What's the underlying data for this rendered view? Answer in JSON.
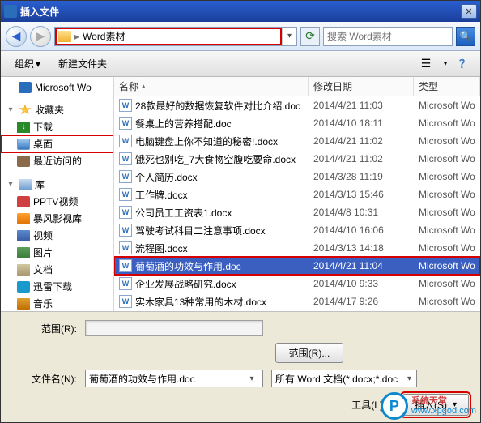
{
  "title": "插入文件",
  "titlebar": {
    "close_symbol": "✕"
  },
  "nav": {
    "back_symbol": "◀",
    "forward_symbol": "▶",
    "path_sep": "▸",
    "path_label": "Word素材",
    "dropdown_symbol": "▾",
    "refresh_symbol": "⟳",
    "search_placeholder": "搜索 Word素材",
    "search_icon": "🔍"
  },
  "toolbar": {
    "organize_label": "组织",
    "new_folder_label": "新建文件夹",
    "dropdown_symbol": "▾",
    "view_icon": "☰",
    "help_icon": "？"
  },
  "sidebar": {
    "items": [
      {
        "label": "Microsoft Wo",
        "icon": "ico-wordapp",
        "indent": 0,
        "expander": ""
      },
      {
        "label": "收藏夹",
        "icon": "ico-fav",
        "indent": 0,
        "expander": "▾"
      },
      {
        "label": "下载",
        "icon": "ico-dl",
        "indent": 1,
        "expander": ""
      },
      {
        "label": "桌面",
        "icon": "ico-desktop",
        "indent": 1,
        "expander": "",
        "highlight": true
      },
      {
        "label": "最近访问的",
        "icon": "ico-recent",
        "indent": 1,
        "expander": ""
      },
      {
        "label": "库",
        "icon": "ico-lib",
        "indent": 0,
        "expander": "▾"
      },
      {
        "label": "PPTV视频",
        "icon": "ico-pptv",
        "indent": 1,
        "expander": ""
      },
      {
        "label": "暴风影视库",
        "icon": "ico-baofeng",
        "indent": 1,
        "expander": ""
      },
      {
        "label": "视频",
        "icon": "ico-video",
        "indent": 1,
        "expander": ""
      },
      {
        "label": "图片",
        "icon": "ico-img",
        "indent": 1,
        "expander": ""
      },
      {
        "label": "文档",
        "icon": "ico-doc",
        "indent": 1,
        "expander": ""
      },
      {
        "label": "迅雷下载",
        "icon": "ico-xunlei",
        "indent": 1,
        "expander": ""
      },
      {
        "label": "音乐",
        "icon": "ico-music",
        "indent": 1,
        "expander": ""
      }
    ]
  },
  "filelist": {
    "columns": {
      "name": "名称",
      "date": "修改日期",
      "type": "类型"
    },
    "sort_symbol": "▴",
    "rows": [
      {
        "name": "28款最好的数据恢复软件对比介绍.doc",
        "date": "2014/4/21 11:03",
        "type": "Microsoft Wo"
      },
      {
        "name": "餐桌上的营养搭配.doc",
        "date": "2014/4/10 18:11",
        "type": "Microsoft Wo"
      },
      {
        "name": "电脑键盘上你不知道的秘密!.docx",
        "date": "2014/4/21 11:02",
        "type": "Microsoft Wo"
      },
      {
        "name": "饿死也别吃_7大食物空腹吃要命.docx",
        "date": "2014/4/21 11:02",
        "type": "Microsoft Wo"
      },
      {
        "name": "个人简历.docx",
        "date": "2014/3/28 11:19",
        "type": "Microsoft Wo"
      },
      {
        "name": "工作牌.docx",
        "date": "2014/3/13 15:46",
        "type": "Microsoft Wo"
      },
      {
        "name": "公司员工工资表1.docx",
        "date": "2014/4/8 10:31",
        "type": "Microsoft Wo"
      },
      {
        "name": "驾驶考试科目二注意事项.docx",
        "date": "2014/4/10 16:06",
        "type": "Microsoft Wo"
      },
      {
        "name": "流程图.docx",
        "date": "2014/3/13 14:18",
        "type": "Microsoft Wo"
      },
      {
        "name": "葡萄酒的功效与作用.doc",
        "date": "2014/4/21 11:04",
        "type": "Microsoft Wo",
        "selected": true
      },
      {
        "name": "企业发展战略研究.docx",
        "date": "2014/4/10 9:33",
        "type": "Microsoft Wo"
      },
      {
        "name": "实木家具13种常用的木材.docx",
        "date": "2014/4/17 9:26",
        "type": "Microsoft Wo"
      }
    ]
  },
  "bottom": {
    "range_label": "范围(R):",
    "range_button": "范围(R)...",
    "filename_label": "文件名(N):",
    "filename_value": "葡萄酒的功效与作用.doc",
    "filter_value": "所有 Word 文档(*.docx;*.doc",
    "tools_label": "工具(L)",
    "insert_label": "插入(S)",
    "dropdown_symbol": "▾",
    "split_symbol": "▾"
  },
  "watermark": {
    "logo_letter": "P",
    "cn": "系统天堂",
    "url": "www.xpgod.com"
  }
}
